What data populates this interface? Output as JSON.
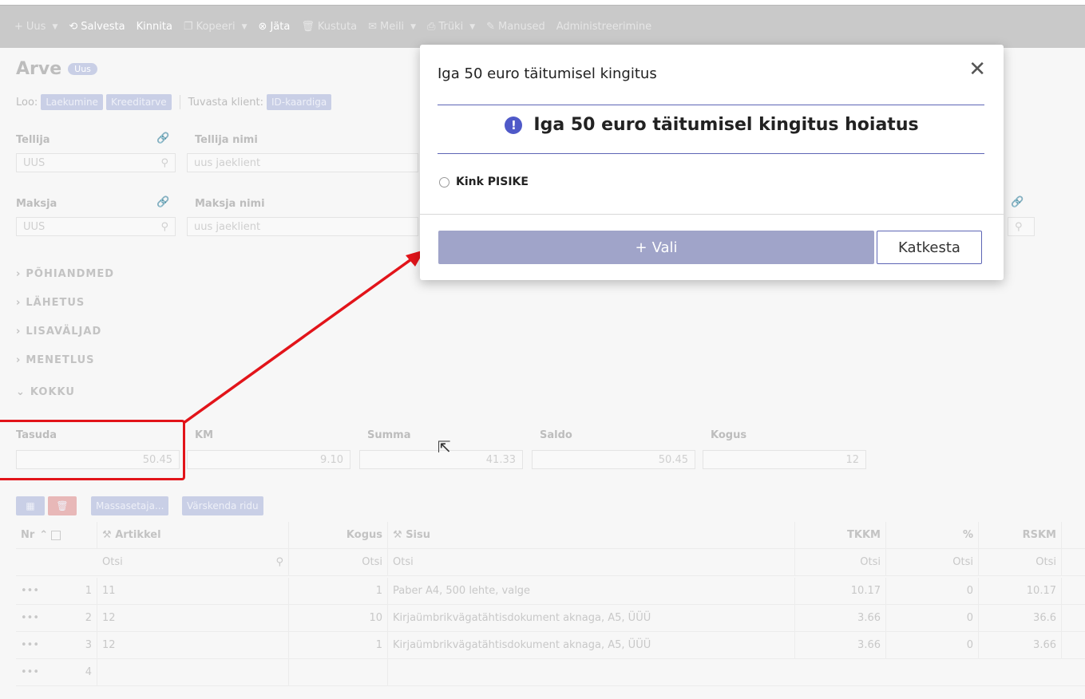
{
  "toolbar": {
    "items": [
      {
        "label": "Uus",
        "icon": "plus-icon"
      },
      {
        "label": "Salvesta",
        "icon": "save-icon"
      },
      {
        "label": "Kinnita"
      },
      {
        "label": "Kopeeri",
        "icon": "copy-icon"
      },
      {
        "label": "Jäta",
        "icon": "close-circle-icon"
      },
      {
        "label": "Kustuta",
        "icon": "trash-icon"
      },
      {
        "label": "Meili",
        "icon": "mail-icon"
      },
      {
        "label": "Trüki",
        "icon": "print-icon"
      },
      {
        "label": "Manused",
        "icon": "attachment-icon"
      },
      {
        "label": "Administreerimine"
      }
    ]
  },
  "form": {
    "title": "Arve",
    "status_badge": "Uus",
    "loo_label": "Loo:",
    "loo_buttons": [
      "Laekumine",
      "Kreeditarve"
    ],
    "tuvasta_label": "Tuvasta klient:",
    "tuvasta_button": "ID-kaardiga",
    "tellija_label": "Tellija",
    "tellija_value": "UUS",
    "tellija_nimi_label": "Tellija nimi",
    "tellija_nimi_value": "uus jaeklient",
    "maksja_label": "Maksja",
    "maksja_value": "UUS",
    "maksja_nimi_label": "Maksja nimi",
    "maksja_nimi_value": "uus jaeklient",
    "sections": [
      "PÕHIANDMED",
      "LÄHETUS",
      "LISAVÄLJAD",
      "MENETLUS",
      "KOKKU"
    ],
    "totals": {
      "tasuda_label": "Tasuda",
      "tasuda_value": "50.45",
      "km_label": "KM",
      "km_value": "9.10",
      "summa_label": "Summa",
      "summa_value": "41.33",
      "saldo_label": "Saldo",
      "saldo_value": "50.45",
      "kogus_label": "Kogus",
      "kogus_value": "12"
    }
  },
  "grid": {
    "massasetaja_label": "Massasetaja...",
    "varskenda_label": "Värskenda ridu",
    "headers": {
      "nr": "Nr",
      "artikkel": "Artikkel",
      "kogus": "Kogus",
      "sisu": "Sisu",
      "tkkm": "TKKM",
      "pct": "%",
      "rskm": "RSKM"
    },
    "search_placeholder": "Otsi",
    "rows": [
      {
        "nr": "1",
        "artikkel": "11",
        "kogus": "1",
        "sisu": "Paber A4, 500 lehte, valge",
        "tkkm": "10.17",
        "pct": "0",
        "rskm": "10.17"
      },
      {
        "nr": "2",
        "artikkel": "12",
        "kogus": "10",
        "sisu": "Kirjaümbrikvägatähtisdokument aknaga, A5, ÜÜÜ",
        "tkkm": "3.66",
        "pct": "0",
        "rskm": "36.6"
      },
      {
        "nr": "3",
        "artikkel": "12",
        "kogus": "1",
        "sisu": "Kirjaümbrikvägatähtisdokument aknaga, A5, ÜÜÜ",
        "tkkm": "3.66",
        "pct": "0",
        "rskm": "3.66"
      },
      {
        "nr": "4",
        "artikkel": "",
        "kogus": "",
        "sisu": "",
        "tkkm": "",
        "pct": "",
        "rskm": ""
      }
    ],
    "row_menu": "•••"
  },
  "modal": {
    "title": "Iga 50 euro täitumisel kingitus",
    "heading": "Iga 50 euro täitumisel kingitus hoiatus",
    "option_label": "Kink PISIKE",
    "select_button": "Vali",
    "cancel_button": "Katkesta",
    "accent": "#5d65b5",
    "select_color": "#a0a4c9"
  },
  "annotation": {
    "color": "#e2141a"
  }
}
